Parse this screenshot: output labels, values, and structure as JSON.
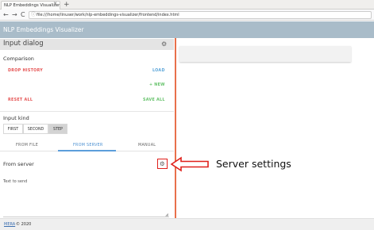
{
  "browser": {
    "tab_title": "NLP Embeddings Visualizer",
    "tab_close": "×",
    "new_tab": "+",
    "nav_back": "←",
    "nav_forward": "→",
    "nav_reload": "C",
    "url_icon": "ⓘ",
    "url": "file:///home/linuser/work/nlp-embeddings-visualizer/frontend/index.html"
  },
  "app": {
    "title": "NLP Embeddings Visualizer"
  },
  "dialog": {
    "title": "Input dialog",
    "settings_icon": "gear-icon",
    "comparison": {
      "heading": "Comparison",
      "drop_history": "DROP HISTORY",
      "load": "LOAD",
      "new": "+ NEW",
      "reset_all": "RESET ALL",
      "save_all": "SAVE ALL"
    },
    "input_kind": {
      "heading": "Input kind",
      "options": [
        "FIRST",
        "SECOND",
        "STEP"
      ],
      "selected": "STEP"
    },
    "tabs": [
      "FROM FILE",
      "FROM SERVER",
      "MANUAL"
    ],
    "active_tab": "FROM SERVER",
    "server": {
      "heading": "From server",
      "text_label": "Text to send"
    }
  },
  "annotation": {
    "label": "Server settings",
    "color": "#e0201b"
  },
  "footer": {
    "link": "MERA",
    "copy": "© 2020"
  },
  "colors": {
    "app_header": "#a9bcc9",
    "divider": "#e8704b",
    "danger": "#e55353",
    "primary": "#5ca6d9",
    "success": "#65c26a"
  }
}
